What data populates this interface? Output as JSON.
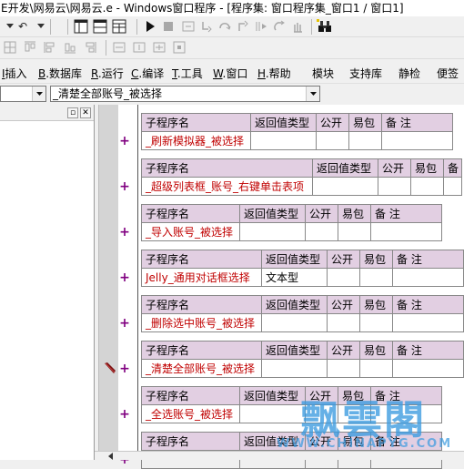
{
  "window": {
    "title": "E开发\\网易云\\网易云.e - Windows窗口程序 - [程序集: 窗口程序集_窗口1 / 窗口1]"
  },
  "toolbar": {
    "undo_glyph": "↶",
    "redo_glyph": "↷"
  },
  "menu": {
    "items": [
      {
        "label_head": "I.",
        "mnemonic": "I",
        "label_tail": "插入"
      },
      {
        "label_head": "",
        "mnemonic": "B",
        "label_tail": ".数据库"
      },
      {
        "label_head": "",
        "mnemonic": "R",
        "label_tail": ".运行"
      },
      {
        "label_head": "",
        "mnemonic": "C",
        "label_tail": ".编译"
      },
      {
        "label_head": "",
        "mnemonic": "T",
        "label_tail": ".工具"
      },
      {
        "label_head": "",
        "mnemonic": "W",
        "label_tail": ".窗口"
      },
      {
        "label_head": "",
        "mnemonic": "H",
        "label_tail": ".帮助"
      },
      {
        "label_head": "",
        "mnemonic": "",
        "label_tail": "模块"
      },
      {
        "label_head": "",
        "mnemonic": "",
        "label_tail": "支持库"
      },
      {
        "label_head": "",
        "mnemonic": "",
        "label_tail": "静检"
      },
      {
        "label_head": "",
        "mnemonic": "",
        "label_tail": "便签"
      }
    ]
  },
  "selectors": {
    "left_value": "",
    "right_value": "_清楚全部账号_被选择"
  },
  "left_panel": {
    "restore_btn": "▫",
    "close_btn": "✕"
  },
  "table_headers": {
    "name": "子程序名",
    "ret": "返回值类型",
    "public": "公开",
    "easy": "易包",
    "note": "备 注"
  },
  "subroutines": [
    {
      "name": "_刷新模拟器_被选择",
      "ret": ""
    },
    {
      "name": "_超级列表框_账号_右键单击表项",
      "ret": ""
    },
    {
      "name": "_导入账号_被选择",
      "ret": ""
    },
    {
      "name": "Jelly_通用对话框选择",
      "ret": "文本型"
    },
    {
      "name": "_删除选中账号_被选择",
      "ret": ""
    },
    {
      "name": "_清楚全部账号_被选择",
      "ret": ""
    },
    {
      "name": "_全选账号_被选择",
      "ret": ""
    },
    {
      "name": "",
      "ret": ""
    }
  ],
  "watermark": {
    "big": "飘雲閣",
    "small": "WWW.CHINAPYG.COM"
  },
  "colors": {
    "header_bg": "#e2cfe2",
    "name_text": "#c00000",
    "plus": "#800080"
  }
}
